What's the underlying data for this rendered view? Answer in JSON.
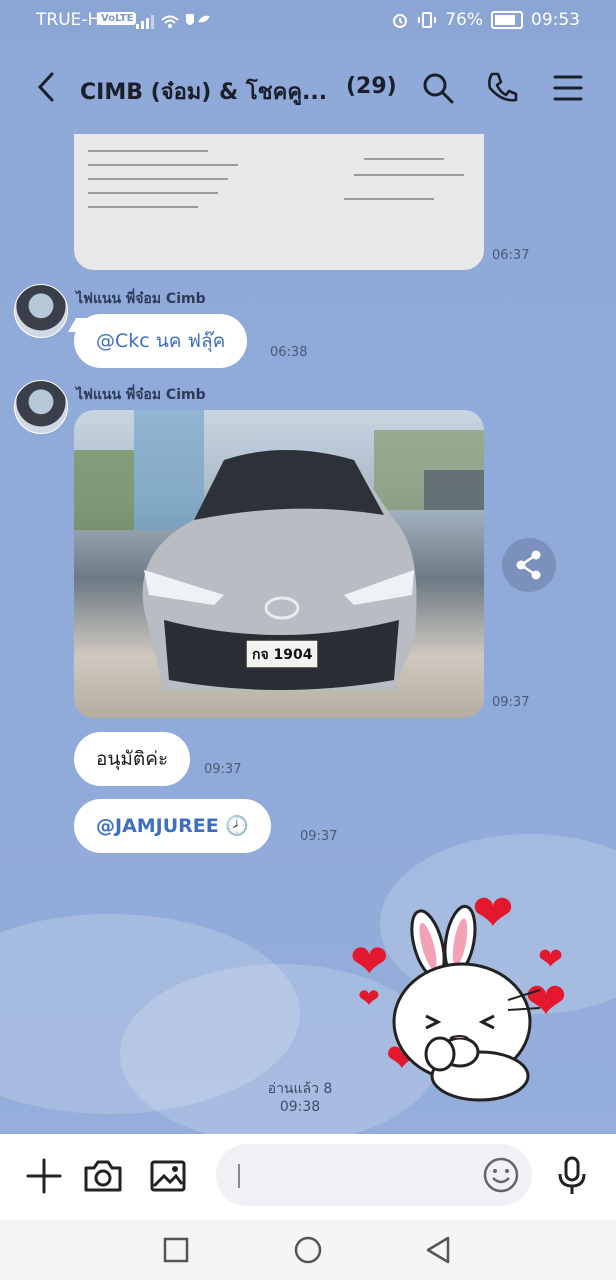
{
  "status": {
    "carrier": "TRUE-H",
    "volte": "VoLTE",
    "battery": "76%",
    "time": "09:53"
  },
  "header": {
    "title": "CIMB (จ๋อม) & โชคคู...",
    "member_count": "(29)"
  },
  "messages": [
    {
      "time": "06:37"
    },
    {
      "sender": "ไฟแนน พี่จ๋อม Cimb",
      "text": "@Ckc นค ฟลุ๊ค",
      "time": "06:38"
    },
    {
      "sender": "ไฟแนน พี่จ๋อม Cimb",
      "time": "09:37"
    },
    {
      "text": "อนุมัติค่ะ",
      "time": "09:37"
    },
    {
      "text": "@JAMJUREE 🕗",
      "time": "09:37"
    }
  ],
  "read_status": {
    "label": "อ่านแล้ว 8",
    "time": "09:38"
  },
  "plate": {
    "text": "กจ 1904"
  },
  "colors": {
    "background": "#8fa9d9",
    "mention": "#3f6fc2",
    "heart": "#e3182c"
  }
}
